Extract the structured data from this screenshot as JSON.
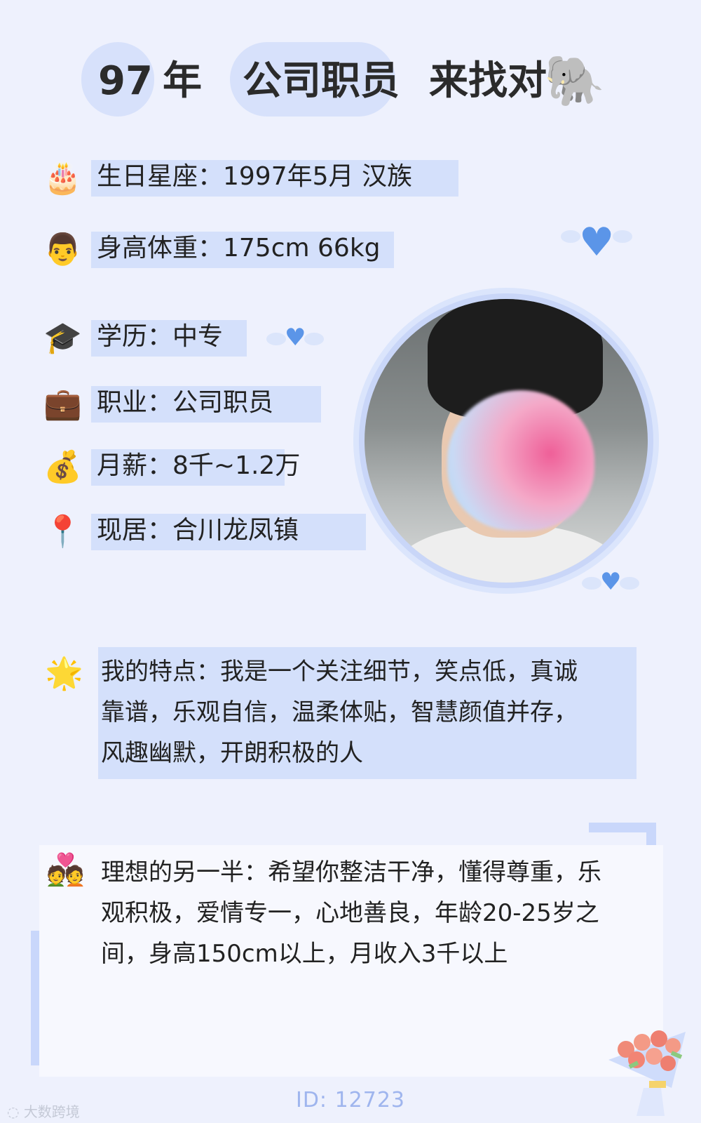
{
  "header": {
    "year": "97",
    "year_suffix": "年",
    "job": "公司职员",
    "seek": "来找对",
    "seek_emoji": "🐘"
  },
  "details": [
    {
      "icon": "🎂",
      "icon_name": "cake-icon",
      "label": "生日星座：1997年5月 汉族"
    },
    {
      "icon": "👨",
      "icon_name": "man-face-icon",
      "label": "身高体重：175cm 66kg"
    },
    {
      "icon": "🎓",
      "icon_name": "graduation-cap-icon",
      "label": "学历：中专"
    },
    {
      "icon": "💼",
      "icon_name": "briefcase-icon",
      "label": "职业：公司职员"
    },
    {
      "icon": "💰",
      "icon_name": "money-bag-icon",
      "label": "月薪：8千~1.2万"
    },
    {
      "icon": "📍",
      "icon_name": "location-pin-icon",
      "label": "现居：合川龙凤镇"
    }
  ],
  "traits": {
    "icon": "🌟",
    "line1": "我的特点：我是一个关注细节，笑点低，真诚",
    "line2": "靠谱，乐观自信，温柔体贴，智慧颜值并存，",
    "line3": "风趣幽默，开朗积极的人"
  },
  "ideal": {
    "icon": "💑",
    "line1": "理想的另一半：希望你整洁干净，懂得尊重，乐",
    "line2": "观积极，爱情专一，心地善良，年龄20-25岁之",
    "line3": "间，身高150cm以上，月收入3千以上"
  },
  "footer": {
    "id": "ID: 12723",
    "watermark": "大数跨境"
  },
  "colors": {
    "background": "#eef1fd",
    "highlight": "#d4e0fb",
    "accent_heart": "#5b95e8",
    "id_text": "#9fb5ee"
  }
}
